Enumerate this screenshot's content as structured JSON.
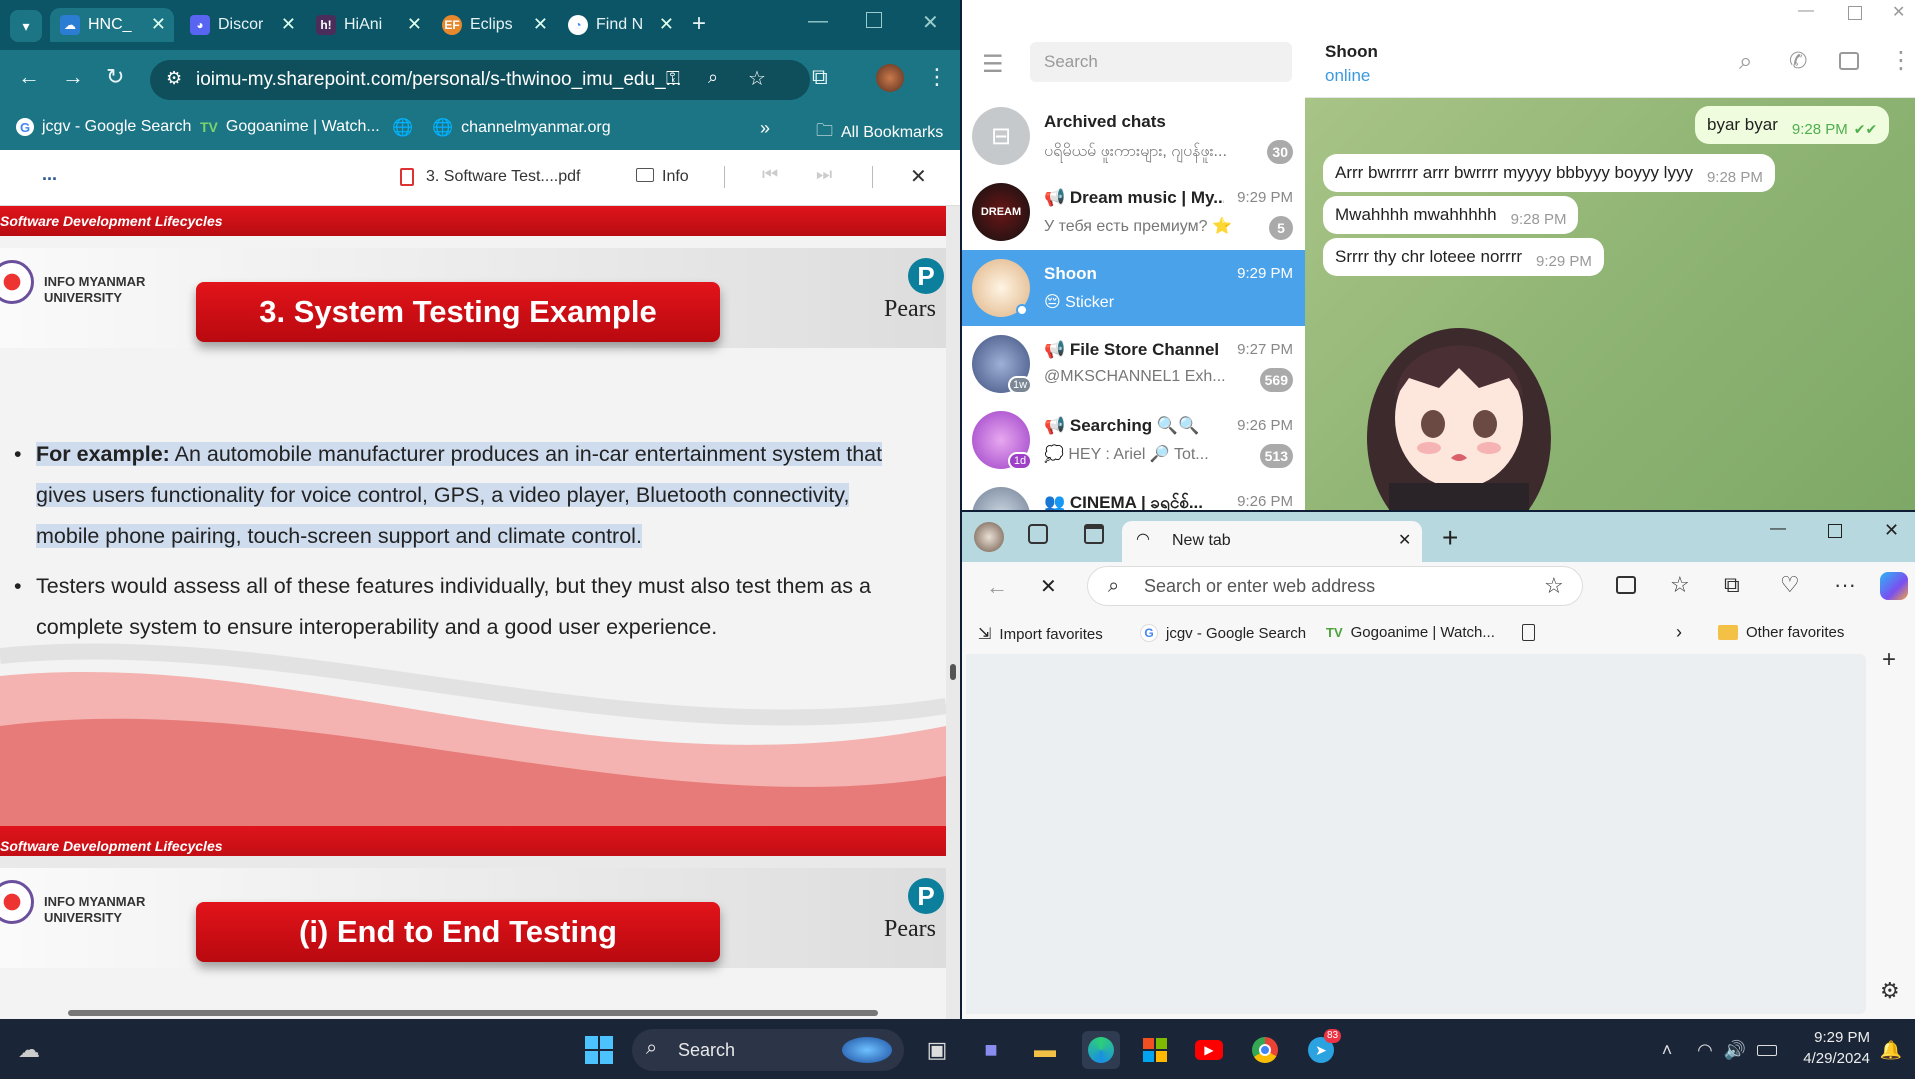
{
  "chrome": {
    "tabs": [
      {
        "label": "HNC_",
        "favicon": "onedrive-icon",
        "color": "#2b7cd3",
        "active": true
      },
      {
        "label": "Discor",
        "favicon": "discord-icon",
        "color": "#5865f2"
      },
      {
        "label": "HiAni",
        "favicon": "hianime-icon",
        "color": "#4b2d5c"
      },
      {
        "label": "Eclips",
        "favicon": "eclipse-icon",
        "color": "#e8882d"
      },
      {
        "label": "Find N",
        "favicon": "google-icon",
        "color": "#4285f4"
      }
    ],
    "new_tab": "+",
    "url": "ioimu-my.sharepoint.com/personal/s-thwinoo_imu_edu_...",
    "bookmarks": [
      {
        "label": "jcgv - Google Search"
      },
      {
        "label": "Gogoanime | Watch..."
      },
      {
        "label": "channelmyanmar.org"
      }
    ],
    "all_bookmarks": "All Bookmarks",
    "pdf": {
      "more": "...",
      "filename": "3. Software Test....pdf",
      "info": "Info",
      "band_text": "Software Development Lifecycles",
      "university": "INFO MYANMAR UNIVERSITY",
      "uni_line1": "INFO MYANMAR",
      "uni_line2": "UNIVERSITY",
      "publisher": "Pears",
      "publisher_logo": "P",
      "slide1_title": "3. System Testing Example",
      "bullet1_bold": "For example:",
      "bullet1_l1": " An automobile manufacturer produces an in-car entertainment system that",
      "bullet1_l2": "gives users functionality for voice control, GPS, a video player, Bluetooth connectivity,",
      "bullet1_l3": "mobile phone pairing, touch-screen support and climate control.",
      "bullet2_l1": "Testers would assess all of these features individually, but they must also test them as a",
      "bullet2_l2": "complete system to ensure interoperability and a good user experience.",
      "slide2_title": "(i) End to End Testing"
    }
  },
  "telegram": {
    "search_placeholder": "Search",
    "chats": [
      {
        "name": "Archived chats",
        "preview": "ပရိမိယမ် ဖူးကားများ, ဂျပန်ဖူး...",
        "time": "",
        "badge": "30"
      },
      {
        "name": "📢 Dream music | My...",
        "preview": "У тебя есть премиум? ⭐",
        "time": "9:29 PM",
        "badge": "5"
      },
      {
        "name": "Shoon",
        "preview": "😔 Sticker",
        "time": "9:29 PM",
        "badge": ""
      },
      {
        "name": "📢 File Store Channel 1",
        "preview": "@MKSCHANNEL1 Exh...",
        "time": "9:27 PM",
        "badge": "569"
      },
      {
        "name": "📢 Searching 🔍🔍",
        "preview": "💭 HEY  : Ariel 🔎 Tot...",
        "time": "9:26 PM",
        "badge": "513"
      },
      {
        "name": "👥 CINEMA | ခရင်စ်...",
        "preview": "",
        "time": "9:26 PM",
        "badge": ""
      }
    ],
    "contact_name": "Shoon",
    "contact_status": "online",
    "messages": [
      {
        "text": "byar byar",
        "time": "9:28 PM",
        "out": true
      },
      {
        "text": "Arrr bwrrrrr arrr bwrrrr myyyy bbbyyy boyyy lyyy",
        "time": "9:28 PM",
        "out": false
      },
      {
        "text": "Mwahhhh mwahhhhh",
        "time": "9:28 PM",
        "out": false
      },
      {
        "text": "Srrrr thy chr loteee norrrr",
        "time": "9:29 PM",
        "out": false
      }
    ],
    "avatar_badges": [
      "1w",
      "1d"
    ]
  },
  "edge": {
    "tab_title": "New tab",
    "new_tab": "+",
    "omnibox_placeholder": "Search or enter web address",
    "bookmarks": [
      {
        "label": "Import favorites"
      },
      {
        "label": "jcgv - Google Search"
      },
      {
        "label": "Gogoanime | Watch..."
      }
    ],
    "other_favorites": "Other favorites",
    "more": "···"
  },
  "taskbar": {
    "search_label": "Search",
    "telegram_badge": "83",
    "time": "9:29 PM",
    "date": "4/29/2024"
  }
}
